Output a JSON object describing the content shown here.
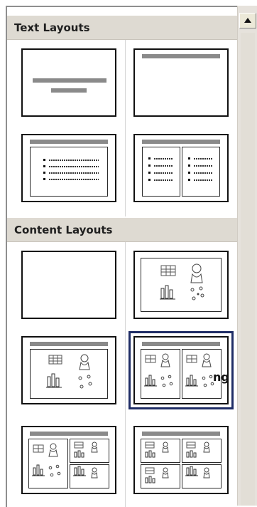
{
  "panel": {
    "sections": [
      {
        "title": "Text Layouts"
      },
      {
        "title": "Content Layouts"
      }
    ],
    "overflow_text": "ng"
  },
  "scroll": {
    "up_arrow_icon": "triangle-up"
  }
}
